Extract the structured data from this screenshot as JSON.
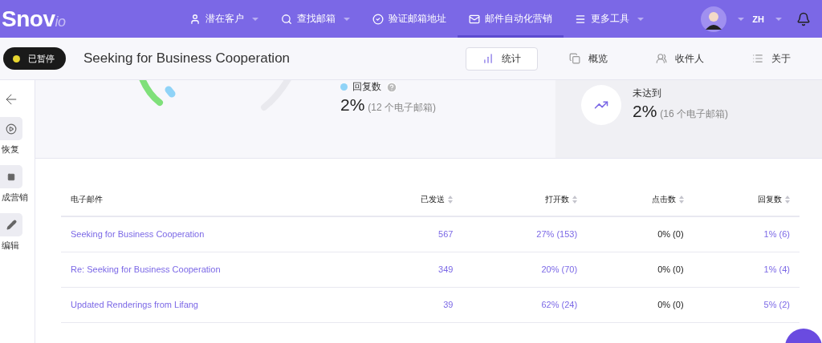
{
  "logo": {
    "main": "Snov",
    "suffix": "io"
  },
  "nav": [
    {
      "label": "潜在客户",
      "dropdown": true,
      "selected": false
    },
    {
      "label": "查找邮箱",
      "dropdown": true,
      "selected": false
    },
    {
      "label": "验证邮箱地址",
      "dropdown": false,
      "selected": false
    },
    {
      "label": "邮件自动化营销",
      "dropdown": false,
      "selected": true
    },
    {
      "label": "更多工具",
      "dropdown": true,
      "selected": false
    }
  ],
  "language": "ZH",
  "campaign": {
    "status": "已暂停",
    "title": "Seeking for Business Cooperation"
  },
  "tabs": [
    {
      "label": "统计",
      "selected": true
    },
    {
      "label": "概览",
      "selected": false
    },
    {
      "label": "收件人",
      "selected": false
    },
    {
      "label": "关于",
      "selected": false
    }
  ],
  "sidebar": [
    {
      "label": "恢复"
    },
    {
      "label": "成营销"
    },
    {
      "label": "编辑"
    }
  ],
  "stats": {
    "reply": {
      "label": "回复数",
      "color": "#8fd3f7",
      "value": "2%",
      "detail": "(12 个电子邮箱)"
    },
    "bounce": {
      "label": "未达到",
      "value": "2%",
      "detail": "(16 个电子邮箱)"
    }
  },
  "table": {
    "columns": [
      {
        "label": "电子邮件",
        "linked": true,
        "sortable": false
      },
      {
        "label": "已发送",
        "linked": true,
        "sortable": true
      },
      {
        "label": "打开数",
        "linked": true,
        "sortable": true
      },
      {
        "label": "点击数",
        "linked": false,
        "sortable": true
      },
      {
        "label": "回复数",
        "linked": true,
        "sortable": true
      }
    ],
    "rows": [
      [
        "Seeking for Business Cooperation",
        "567",
        "27% (153)",
        "0% (0)",
        "1% (6)"
      ],
      [
        "Re: Seeking for Business Cooperation",
        "349",
        "20% (70)",
        "0% (0)",
        "1% (4)"
      ],
      [
        "Updated Renderings from Lifang",
        "39",
        "62% (24)",
        "0% (0)",
        "5% (2)"
      ]
    ]
  }
}
